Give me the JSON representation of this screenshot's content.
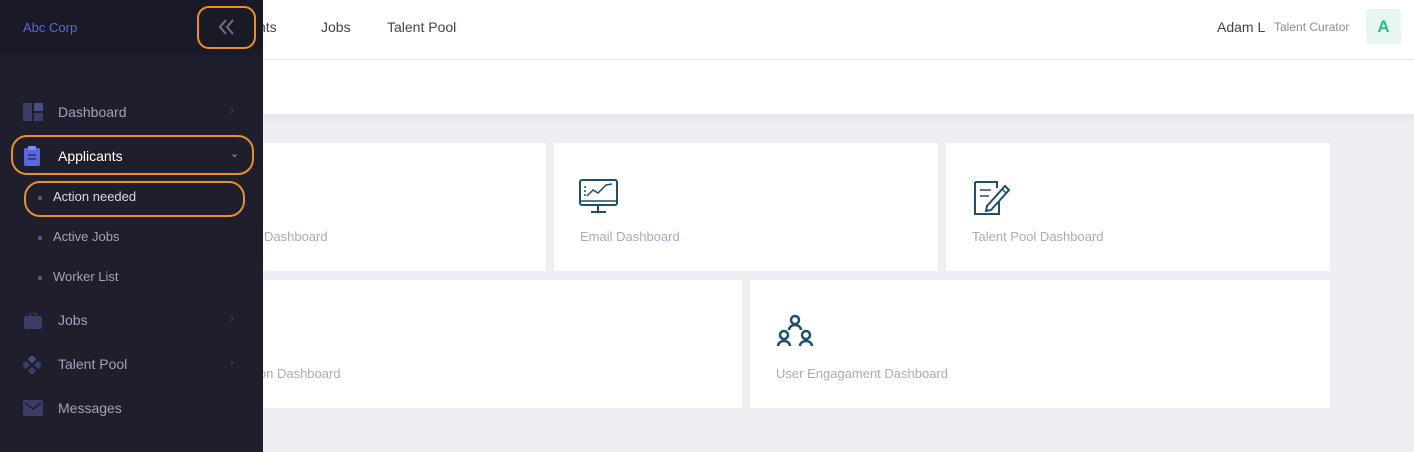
{
  "topnav": {
    "items": [
      "nts",
      "Jobs",
      "Talent Pool"
    ]
  },
  "user": {
    "name": "Adam L",
    "role": "Talent Curator",
    "avatar_initial": "A"
  },
  "cards": {
    "row1": [
      {
        "label": "Dashboard",
        "icon": "dashboard-icon"
      },
      {
        "label": "Email Dashboard",
        "icon": "monitor-chart-icon"
      },
      {
        "label": "Talent Pool Dashboard",
        "icon": "clipboard-pen-icon"
      }
    ],
    "row2": [
      {
        "label": "ion Dashboard",
        "icon": "none"
      },
      {
        "label": "User Engagament Dashboard",
        "icon": "people-network-icon"
      }
    ]
  },
  "sidebar": {
    "brand": "Abc Corp",
    "toggle_icon": "double-chevron-left-icon",
    "items": [
      {
        "label": "Dashboard",
        "icon": "dashboard-icon",
        "chevron": "›"
      },
      {
        "label": "Applicants",
        "icon": "clipboard-icon",
        "chevron": "⌄"
      },
      {
        "label": "Jobs",
        "icon": "briefcase-icon",
        "chevron": "›"
      },
      {
        "label": "Talent Pool",
        "icon": "diamond-grid-icon",
        "chevron": "›"
      },
      {
        "label": "Messages",
        "icon": "mail-icon"
      }
    ],
    "subitems": [
      {
        "label": "Action needed"
      },
      {
        "label": "Active Jobs"
      },
      {
        "label": "Worker List"
      }
    ]
  },
  "colors": {
    "sidebar_bg": "#1e1e2d",
    "highlight": "#e8902a",
    "brand": "#5867dd",
    "avatar_text": "#2dbd84",
    "icon_teal": "#1f4f6e"
  }
}
